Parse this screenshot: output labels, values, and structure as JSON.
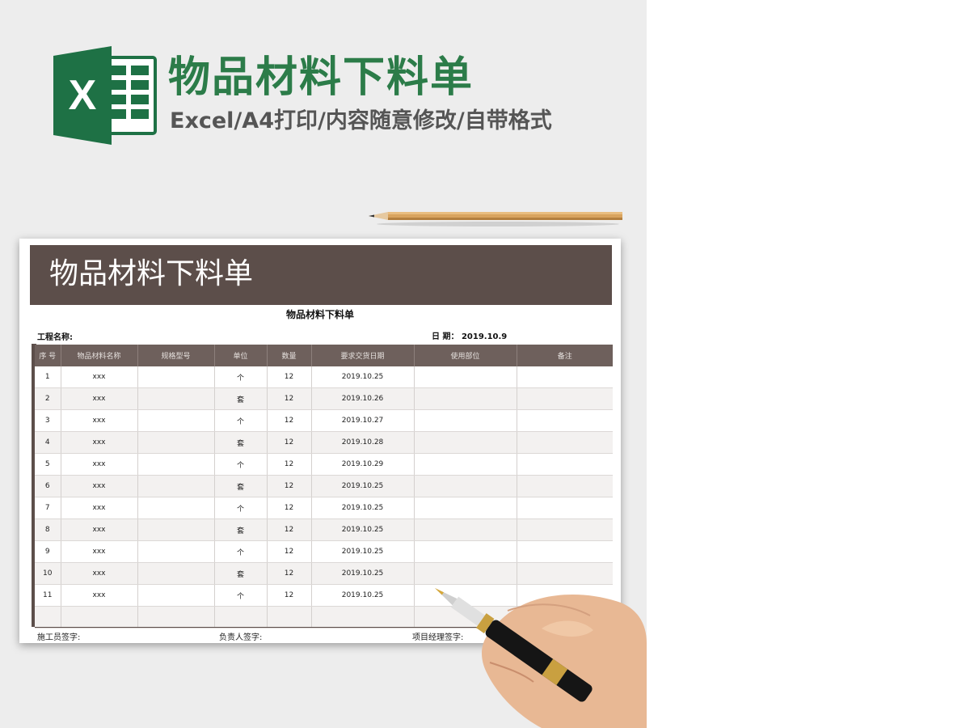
{
  "header": {
    "title": "物品材料下料单",
    "subtitle": "Excel/A4打印/内容随意修改/自带格式",
    "logo_letter": "X"
  },
  "sheet": {
    "banner_title": "物品材料下料单",
    "title": "物品材料下料单",
    "project_label": "工程名称:",
    "date_label": "日 期： 2019.10.9",
    "columns": [
      "序 号",
      "物品材料名称",
      "规格型号",
      "单位",
      "数量",
      "要求交货日期",
      "使用部位",
      "备注"
    ],
    "rows": [
      [
        "1",
        "xxx",
        "",
        "个",
        "12",
        "2019.10.25",
        "",
        ""
      ],
      [
        "2",
        "xxx",
        "",
        "套",
        "12",
        "2019.10.26",
        "",
        ""
      ],
      [
        "3",
        "xxx",
        "",
        "个",
        "12",
        "2019.10.27",
        "",
        ""
      ],
      [
        "4",
        "xxx",
        "",
        "套",
        "12",
        "2019.10.28",
        "",
        ""
      ],
      [
        "5",
        "xxx",
        "",
        "个",
        "12",
        "2019.10.29",
        "",
        ""
      ],
      [
        "6",
        "xxx",
        "",
        "套",
        "12",
        "2019.10.25",
        "",
        ""
      ],
      [
        "7",
        "xxx",
        "",
        "个",
        "12",
        "2019.10.25",
        "",
        ""
      ],
      [
        "8",
        "xxx",
        "",
        "套",
        "12",
        "2019.10.25",
        "",
        ""
      ],
      [
        "9",
        "xxx",
        "",
        "个",
        "12",
        "2019.10.25",
        "",
        ""
      ],
      [
        "10",
        "xxx",
        "",
        "套",
        "12",
        "2019.10.25",
        "",
        ""
      ],
      [
        "11",
        "xxx",
        "",
        "个",
        "12",
        "2019.10.25",
        "",
        ""
      ],
      [
        "",
        "",
        "",
        "",
        "",
        "",
        "",
        ""
      ]
    ],
    "signatures": [
      "施工员签字:",
      "负责人签字:",
      "项目经理签字:"
    ]
  },
  "colors": {
    "brand_green": "#2c7c49",
    "banner_brown": "#5c4e4a",
    "header_brown": "#6e605c"
  },
  "icons": [
    "excel-logo-icon",
    "pencil-icon",
    "hand-with-pen-icon"
  ]
}
